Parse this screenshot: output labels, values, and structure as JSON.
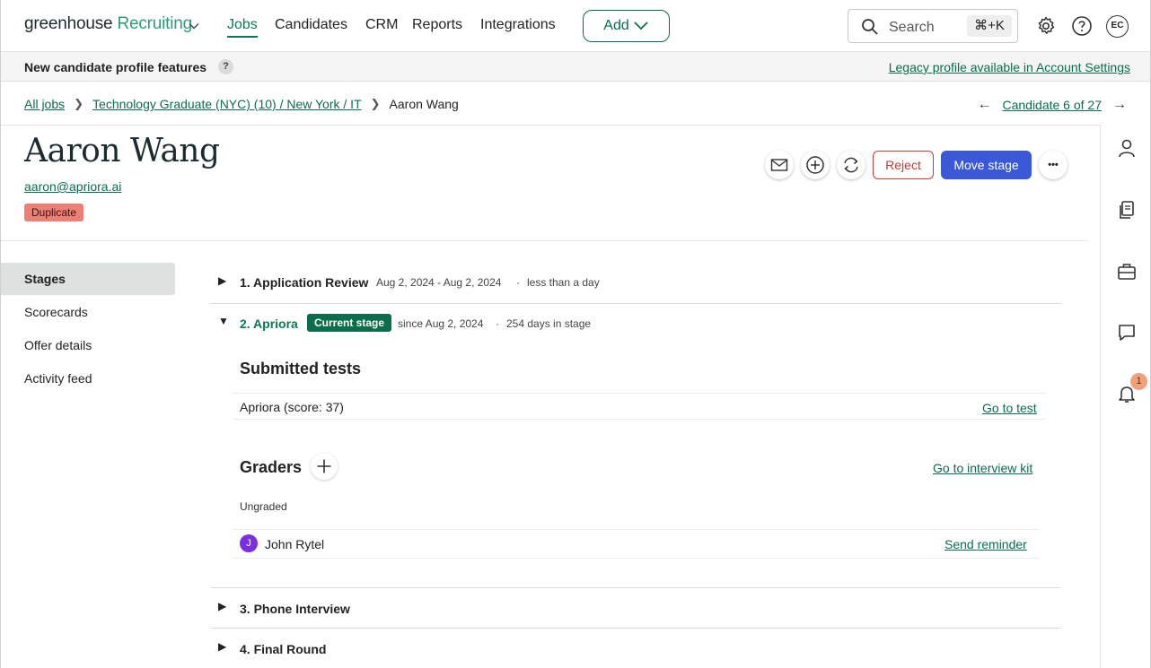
{
  "topnav": {
    "logo_main": "greenhouse",
    "logo_accent": "Recruiting",
    "items": [
      "Jobs",
      "Candidates",
      "CRM",
      "Reports",
      "Integrations"
    ],
    "add_label": "Add",
    "search_placeholder": "Search",
    "search_shortcut": "⌘+K",
    "user_initials": "EC"
  },
  "banner": {
    "text": "New candidate profile features",
    "help": "?",
    "link": "Legacy profile available in Account Settings"
  },
  "breadcrumb": {
    "all_jobs": "All jobs",
    "job": "Technology Graduate (NYC) (10) / New York / IT",
    "current": "Aaron Wang",
    "candidate_pos": "Candidate 6 of 27"
  },
  "candidate": {
    "name": "Aaron Wang",
    "email": "aaron@apriora.ai",
    "badge": "Duplicate"
  },
  "actions": {
    "reject": "Reject",
    "move_stage": "Move stage",
    "more": "•••"
  },
  "sidebar": {
    "items": [
      "Stages",
      "Scorecards",
      "Offer details",
      "Activity feed"
    ]
  },
  "stages": {
    "s1": {
      "title": "1. Application Review",
      "dates": "Aug 2, 2024 - Aug 2, 2024",
      "dot": "·",
      "duration": "less than a day"
    },
    "s2": {
      "title": "2. Apriora",
      "badge": "Current stage",
      "since": "since Aug 2, 2024",
      "dot": "·",
      "duration": "254 days in stage"
    },
    "s3": {
      "title": "3. Phone Interview"
    },
    "s4": {
      "title": "4. Final Round"
    }
  },
  "submitted_tests": {
    "title": "Submitted tests",
    "test_name": "Apriora (score: 37)",
    "test_link": "Go to test"
  },
  "graders": {
    "title": "Graders",
    "kit_link": "Go to interview kit",
    "status": "Ungraded",
    "grader_initial": "J",
    "grader_name": "John Rytel",
    "reminder": "Send reminder"
  },
  "notifications": {
    "count": "1"
  },
  "colors": {
    "brand_green": "#0b6d49",
    "primary_blue": "#3b59d6",
    "reject_red": "#c43b35",
    "duplicate_badge": "#ec7f76",
    "grader_avatar": "#7a2fe0"
  }
}
